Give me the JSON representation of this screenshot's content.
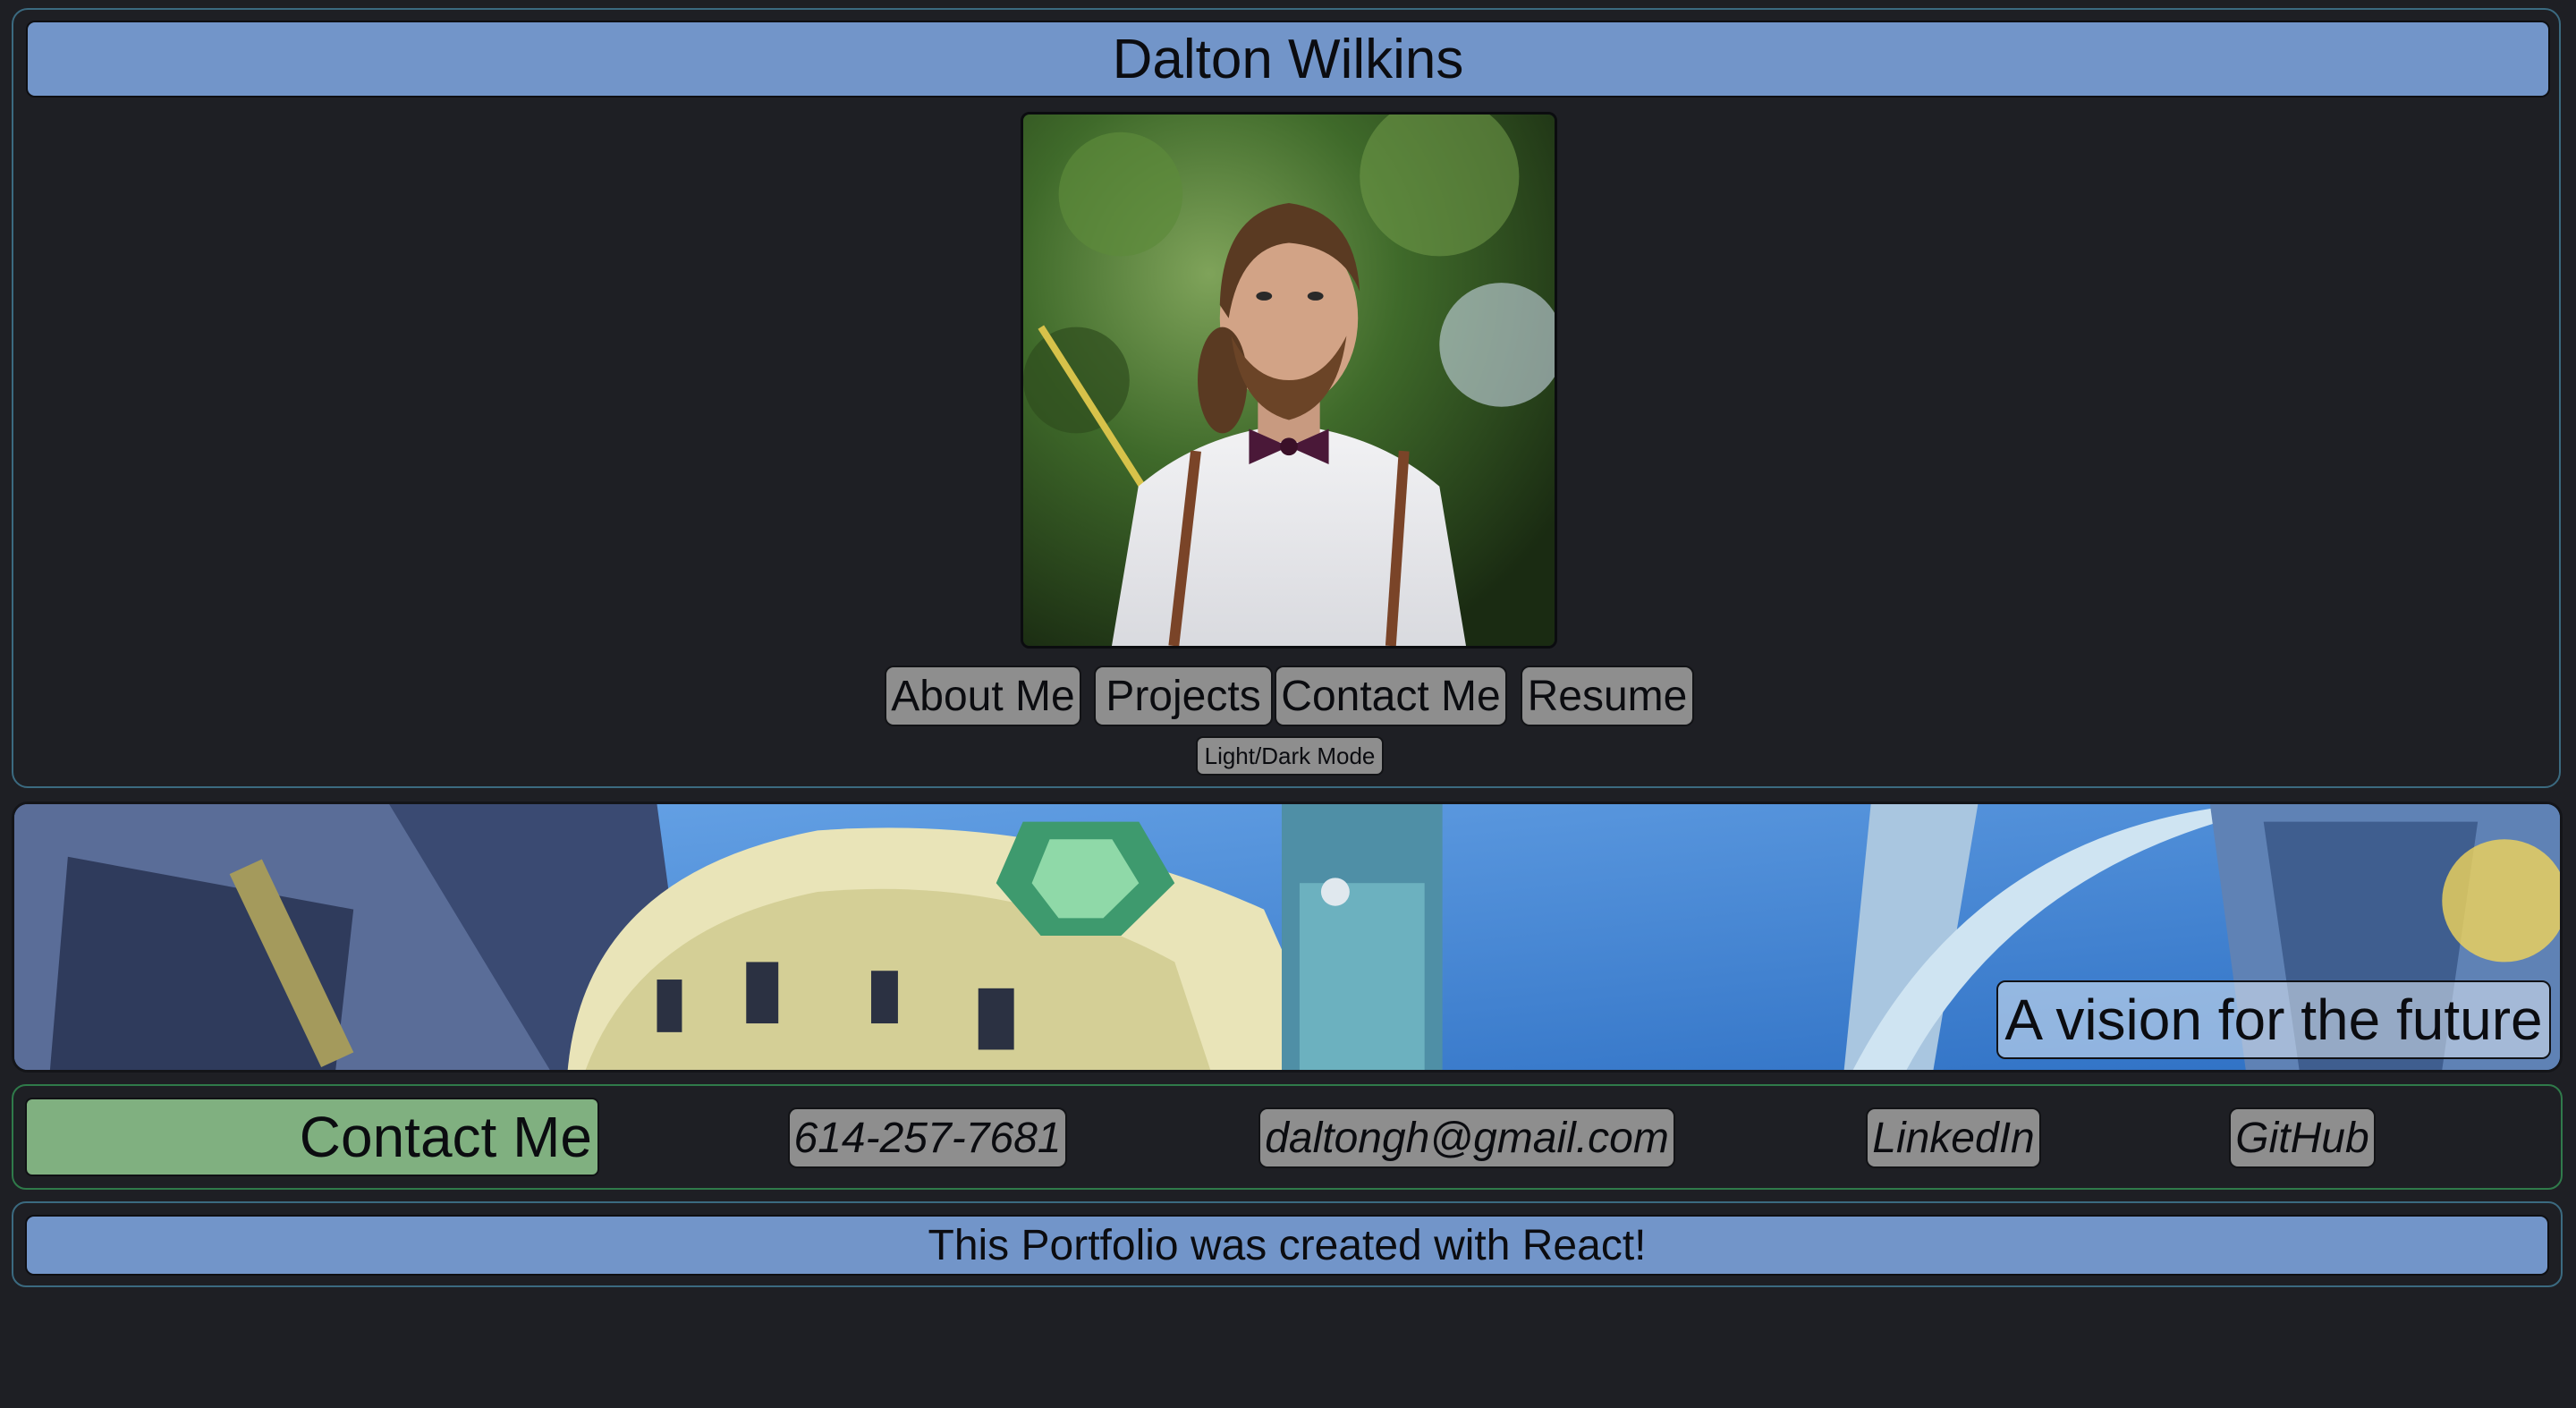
{
  "header": {
    "name": "Dalton Wilkins"
  },
  "nav": {
    "items": [
      {
        "label": "About Me"
      },
      {
        "label": "Projects"
      },
      {
        "label": "Contact Me"
      },
      {
        "label": "Resume"
      }
    ],
    "mode_toggle": "Light/Dark Mode"
  },
  "banner": {
    "caption": "A vision for the future"
  },
  "contact": {
    "heading": "Contact Me",
    "phone": "614-257-7681",
    "email": "daltongh@gmail.com",
    "linkedin": "LinkedIn",
    "github": "GitHub"
  },
  "footer": {
    "text": "This Portfolio was created with React!"
  },
  "colors": {
    "background": "#1e1f24",
    "header_bar": "#7295c9",
    "contact_heading": "#80b080",
    "button": "#8e8e8e"
  }
}
